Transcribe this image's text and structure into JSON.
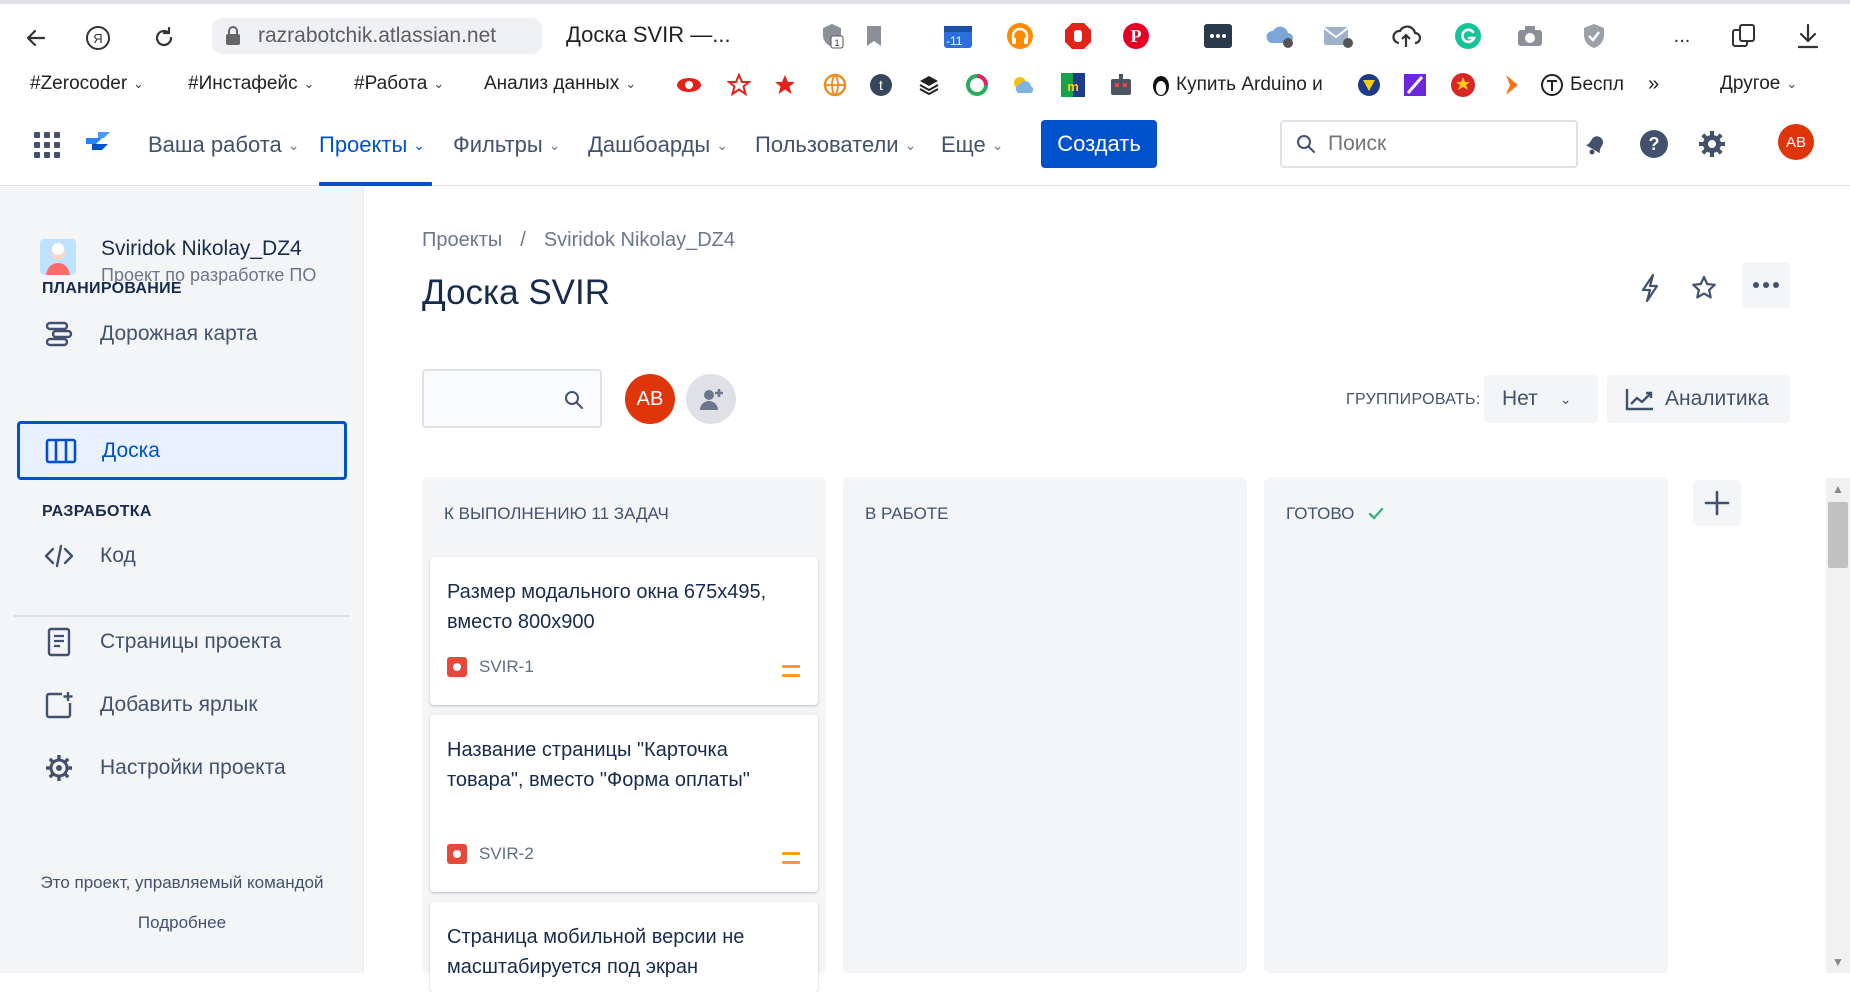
{
  "browser": {
    "url": "razrabotchik.atlassian.net",
    "tab_title": "Доска SVIR —...",
    "ext_badge": "-11",
    "overflow": "...",
    "bookmarks": [
      {
        "label": "#Zerocoder"
      },
      {
        "label": "#Инстафейс"
      },
      {
        "label": "#Работа"
      },
      {
        "label": "Анализ данных"
      }
    ],
    "bookmark_arduino": "Купить Arduino и",
    "bookmark_besp": "Беспл",
    "bookmark_more": "»",
    "bookmark_other": "Другое"
  },
  "topnav": {
    "items": [
      {
        "label": "Ваша работа"
      },
      {
        "label": "Проекты"
      },
      {
        "label": "Фильтры"
      },
      {
        "label": "Дашбоарды"
      },
      {
        "label": "Пользователи"
      },
      {
        "label": "Еще"
      }
    ],
    "create_label": "Создать",
    "search_placeholder": "Поиск",
    "avatar_initials": "AB",
    "accent": "#0052cc"
  },
  "sidebar": {
    "project_name": "Sviridok Nikolay_DZ4",
    "project_sub": "Проект по разработке ПО",
    "section_planning": "ПЛАНИРОВАНИЕ",
    "roadmap": "Дорожная карта",
    "board": "Доска",
    "section_dev": "РАЗРАБОТКА",
    "code": "Код",
    "pages": "Страницы проекта",
    "add_shortcut": "Добавить ярлык",
    "settings": "Настройки проекта",
    "footer_text": "Это проект, управляемый командой",
    "footer_link": "Подробнее"
  },
  "main": {
    "breadcrumb_root": "Проекты",
    "breadcrumb_sep": "/",
    "breadcrumb_project": "Sviridok Nikolay_DZ4",
    "title": "Доска SVIR",
    "avatar_initials": "AB",
    "group_label": "ГРУППИРОВАТЬ:",
    "group_value": "Нет",
    "analytics_label": "Аналитика"
  },
  "columns": [
    {
      "title": "К ВЫПОЛНЕНИЮ 11 ЗАДАЧ"
    },
    {
      "title": "В РАБОТЕ"
    },
    {
      "title": "ГОТОВО"
    }
  ],
  "cards": [
    {
      "text": "Размер модального окна 675x495, вместо 800x900",
      "key": "SVIR-1",
      "priority": "medium"
    },
    {
      "text": "Название страницы \"Карточка товара\", вместо \"Форма оплаты\"",
      "key": "SVIR-2",
      "priority": "medium"
    },
    {
      "text": "Страница мобильной версии не масштабируется под экран",
      "key": ""
    }
  ]
}
